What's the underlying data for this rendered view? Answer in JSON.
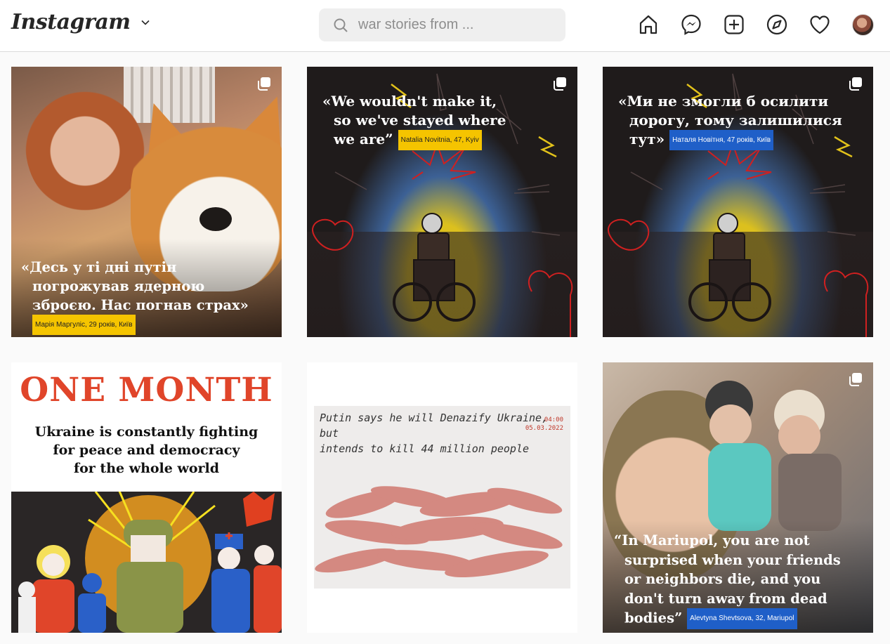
{
  "header": {
    "logo": "Instagram",
    "search": {
      "value": "",
      "placeholder": "war stories from ..."
    },
    "nav": [
      "home-icon",
      "messenger-icon",
      "new-post-icon",
      "explore-icon",
      "activity-heart-icon",
      "profile-avatar"
    ]
  },
  "posts": [
    {
      "quote_lines": [
        "«Десь у ті дні путін",
        "погрожував ядерною",
        "зброєю. Нас погнав страх»"
      ],
      "tag": "Марія Маргуліс, 29 років, Київ",
      "tag_color": "#f5c400",
      "multiple": true
    },
    {
      "quote_lines": [
        "«We wouldn't make it,",
        "so we've stayed where",
        "we are”"
      ],
      "tag": "Natalia Novitnia, 47, Kyiv",
      "tag_color": "#f5c400",
      "multiple": true
    },
    {
      "quote_lines": [
        "«Ми не змогли б осилити",
        "дорогу, тому залишилися",
        "тут»"
      ],
      "tag": "Наталя Новітня, 47 років, Київ",
      "tag_color": "#1f5fc8",
      "multiple": true
    },
    {
      "title": "ONE MONTH",
      "subtitle_lines": [
        "Ukraine is constantly fighting",
        "for peace and democracy",
        "for the whole world"
      ],
      "multiple": false
    },
    {
      "note_lines": [
        "Putin says he will Denazify Ukraine, but",
        "intends to kill 44 million people"
      ],
      "time": "04:00",
      "date": "05.03.2022",
      "multiple": false
    },
    {
      "quote_lines": [
        "“In Mariupol, you are not",
        "surprised when your friends",
        "or neighbors die, and you",
        "don't turn away from dead",
        "bodies”"
      ],
      "tag": "Alevtyna Shevtsova, 32, Mariupol",
      "tag_color": "#1f5fc8",
      "multiple": true
    }
  ]
}
